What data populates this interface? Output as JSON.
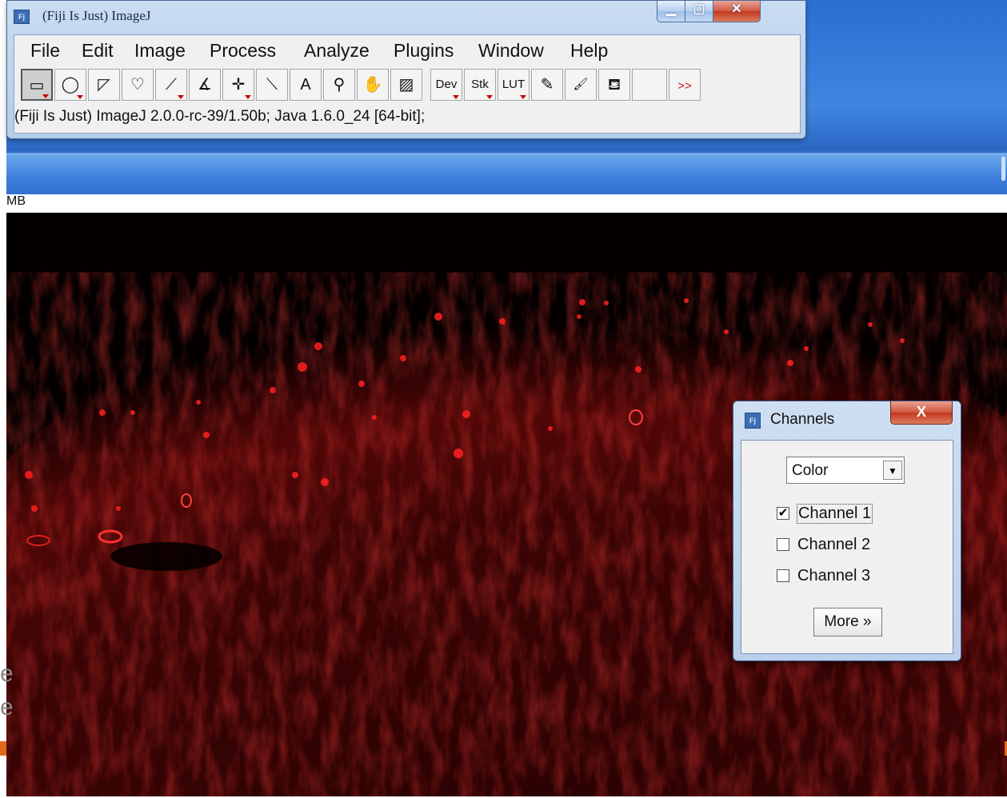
{
  "window": {
    "title": "(Fiji Is Just) ImageJ",
    "app_icon": "fiji-icon",
    "controls": {
      "minimize": "minimize-icon",
      "maximize": "maximize-icon",
      "close": "close-icon"
    }
  },
  "menu": {
    "items": [
      "File",
      "Edit",
      "Image",
      "Process",
      "Analyze",
      "Plugins",
      "Window",
      "Help"
    ]
  },
  "toolbar": {
    "tools": [
      {
        "name": "rectangle-tool",
        "glyph": "▭",
        "selected": true,
        "menu": true
      },
      {
        "name": "oval-tool",
        "glyph": "◯",
        "selected": false,
        "menu": true
      },
      {
        "name": "polygon-tool",
        "glyph": "◸",
        "selected": false,
        "menu": false
      },
      {
        "name": "freehand-tool",
        "glyph": "♡",
        "selected": false,
        "menu": false
      },
      {
        "name": "line-tool",
        "glyph": "⟋",
        "selected": false,
        "menu": true
      },
      {
        "name": "angle-tool",
        "glyph": "∡",
        "selected": false,
        "menu": false
      },
      {
        "name": "point-tool",
        "glyph": "✛",
        "selected": false,
        "menu": true
      },
      {
        "name": "wand-tool",
        "glyph": "⟍",
        "selected": false,
        "menu": false
      },
      {
        "name": "text-tool",
        "glyph": "A",
        "selected": false,
        "menu": false
      },
      {
        "name": "magnifier-tool",
        "glyph": "⚲",
        "selected": false,
        "menu": false
      },
      {
        "name": "hand-tool",
        "glyph": "✋",
        "selected": false,
        "menu": false
      },
      {
        "name": "color-picker-tool",
        "glyph": "▨",
        "selected": false,
        "menu": false
      },
      {
        "name": "dev-tool",
        "glyph": "Dev",
        "selected": false,
        "menu": true
      },
      {
        "name": "stk-tool",
        "glyph": "Stk",
        "selected": false,
        "menu": true
      },
      {
        "name": "lut-tool",
        "glyph": "LUT",
        "selected": false,
        "menu": true
      },
      {
        "name": "pencil-tool",
        "glyph": "✎",
        "selected": false,
        "menu": false
      },
      {
        "name": "brush-tool",
        "glyph": "🖌",
        "selected": false,
        "menu": false
      },
      {
        "name": "flood-fill-tool",
        "glyph": "⛾",
        "selected": false,
        "menu": false
      },
      {
        "name": "empty-slot",
        "glyph": "",
        "selected": false,
        "menu": false
      },
      {
        "name": "more-tools",
        "glyph": ">>",
        "selected": false,
        "menu": false
      }
    ]
  },
  "status": {
    "text": "(Fiji Is Just) ImageJ 2.0.0-rc-39/1.50b; Java 1.6.0_24 [64-bit];"
  },
  "image_window": {
    "info_label": "MB"
  },
  "background_fragments": [
    "e",
    "e"
  ],
  "channels_dialog": {
    "title": "Channels",
    "close_glyph": "X",
    "mode_select": {
      "value": "Color"
    },
    "channels": [
      {
        "label": "Channel 1",
        "checked": true
      },
      {
        "label": "Channel 2",
        "checked": false
      },
      {
        "label": "Channel 3",
        "checked": false
      }
    ],
    "more_button": "More »"
  },
  "colors": {
    "desktop_blue": "#3f86e0",
    "image_red": "#d01010",
    "close_red": "#c83a1f"
  }
}
